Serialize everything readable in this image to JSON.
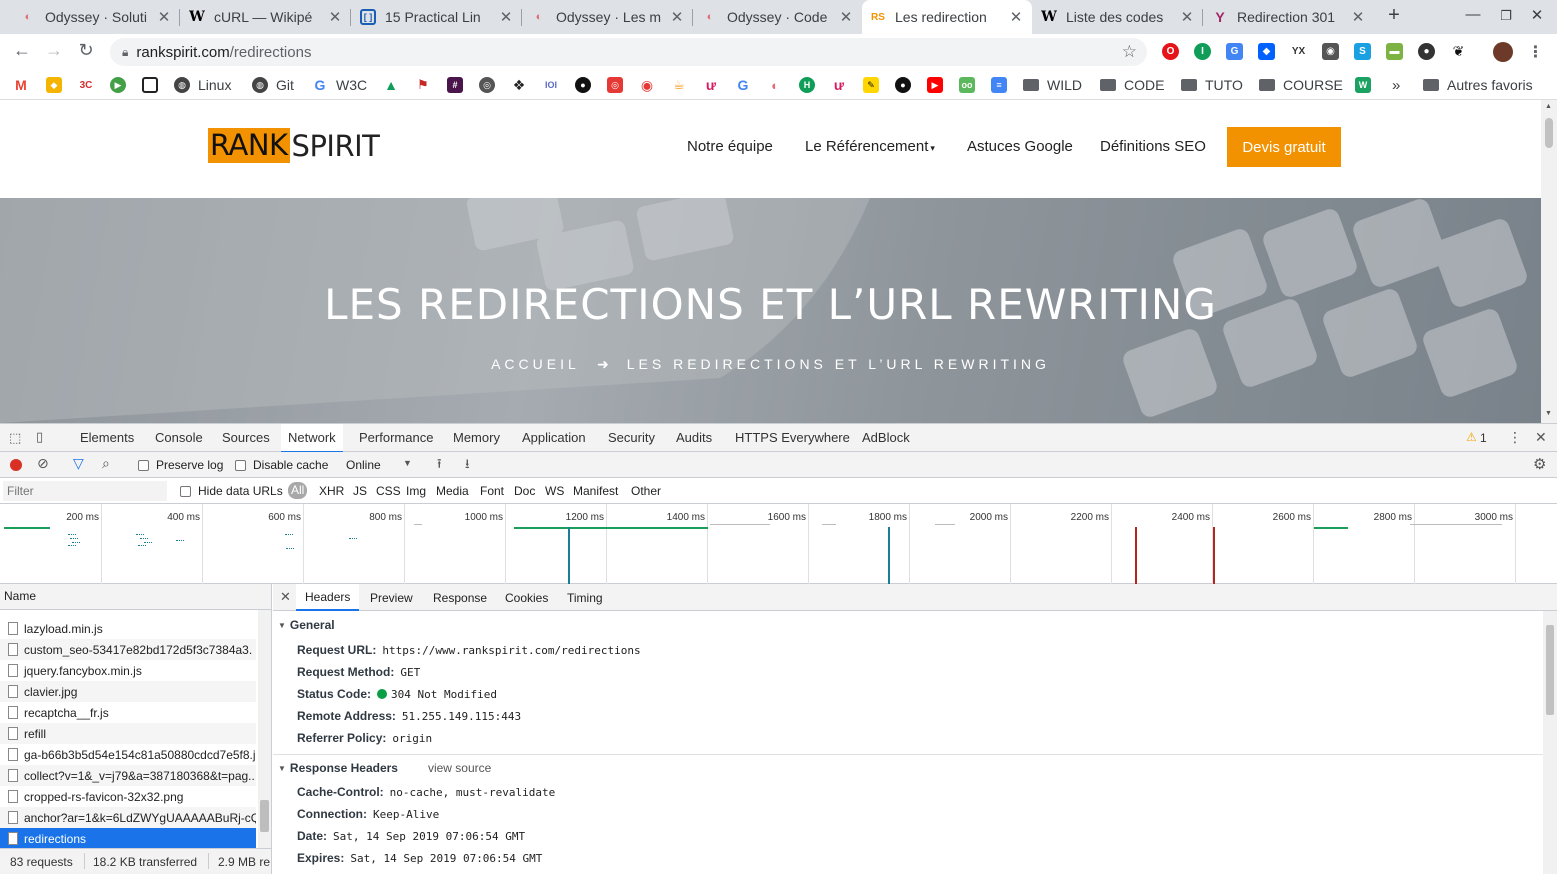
{
  "tabs": [
    {
      "title": "Odyssey · Soluti",
      "icon": "odyssey-icon"
    },
    {
      "title": "cURL — Wikipé",
      "icon": "wikipedia-icon"
    },
    {
      "title": "15 Practical Lin",
      "icon": "bracket-icon"
    },
    {
      "title": "Odyssey · Les m",
      "icon": "odyssey-icon"
    },
    {
      "title": "Odyssey · Code",
      "icon": "odyssey-icon"
    },
    {
      "title": "Les redirection",
      "icon": "rankspirit-icon"
    },
    {
      "title": "Liste des codes",
      "icon": "wikipedia-icon"
    },
    {
      "title": "Redirection 301",
      "icon": "yoast-icon"
    }
  ],
  "url": {
    "host": "rankspirit.com",
    "path": "/redirections"
  },
  "bookmarks": {
    "linux": "Linux",
    "git": "Git",
    "w3c": "W3C",
    "wild": "WILD",
    "code": "CODE",
    "tuto": "TUTO",
    "course": "COURSE",
    "more": "»",
    "others": "Autres favoris"
  },
  "site": {
    "logo_rank": "RANK",
    "logo_spirit": "SPIRIT",
    "nav": {
      "team": "Notre équipe",
      "seo": "Le Référencement",
      "google": "Astuces Google",
      "defs": "Définitions SEO",
      "quote": "Devis gratuit"
    },
    "hero_title": "LES REDIRECTIONS ET L’URL REWRITING",
    "crumb_home": "ACCUEIL",
    "crumb_sep": "➜",
    "crumb_current": "LES REDIRECTIONS ET L’URL REWRITING"
  },
  "devtools": {
    "tabs": [
      "Elements",
      "Console",
      "Sources",
      "Network",
      "Performance",
      "Memory",
      "Application",
      "Security",
      "Audits",
      "HTTPS Everywhere",
      "AdBlock"
    ],
    "warning_count": "1",
    "preserve_log": "Preserve log",
    "disable_cache": "Disable cache",
    "throttle": "Online",
    "filter_placeholder": "Filter",
    "hide_data_urls": "Hide data URLs",
    "types": [
      "All",
      "XHR",
      "JS",
      "CSS",
      "Img",
      "Media",
      "Font",
      "Doc",
      "WS",
      "Manifest",
      "Other"
    ],
    "ticks": [
      "200 ms",
      "400 ms",
      "600 ms",
      "800 ms",
      "1000 ms",
      "1200 ms",
      "1400 ms",
      "1600 ms",
      "1800 ms",
      "2000 ms",
      "2200 ms",
      "2400 ms",
      "2600 ms",
      "2800 ms",
      "3000 ms"
    ],
    "name_header": "Name",
    "requests": [
      "lazyload.min.js",
      "custom_seo-53417e82bd172d5f3c7384a3.",
      "jquery.fancybox.min.js",
      "clavier.jpg",
      "recaptcha__fr.js",
      "refill",
      "ga-b66b3b5d54e154c81a50880cdcd7e5f8.j",
      "collect?v=1&_v=j79&a=387180368&t=pag..",
      "cropped-rs-favicon-32x32.png",
      "anchor?ar=1&k=6LdZWYgUAAAAABuRj-cQ",
      "redirections"
    ],
    "summary": {
      "requests": "83 requests",
      "transferred": "18.2 KB transferred",
      "resources": "2.9 MB re"
    },
    "detail_tabs": [
      "Headers",
      "Preview",
      "Response",
      "Cookies",
      "Timing"
    ],
    "general": {
      "title": "General",
      "request_url_k": "Request URL:",
      "request_url_v": "https://www.rankspirit.com/redirections",
      "method_k": "Request Method:",
      "method_v": "GET",
      "status_k": "Status Code:",
      "status_v": "304 Not Modified",
      "remote_k": "Remote Address:",
      "remote_v": "51.255.149.115:443",
      "referrer_k": "Referrer Policy:",
      "referrer_v": "origin"
    },
    "response_headers": {
      "title": "Response Headers",
      "view_source": "view source",
      "cache_k": "Cache-Control:",
      "cache_v": "no-cache, must-revalidate",
      "conn_k": "Connection:",
      "conn_v": "Keep-Alive",
      "date_k": "Date:",
      "date_v": "Sat, 14 Sep 2019 07:06:54 GMT",
      "expires_k": "Expires:",
      "expires_v": "Sat, 14 Sep 2019 07:06:54 GMT"
    }
  }
}
